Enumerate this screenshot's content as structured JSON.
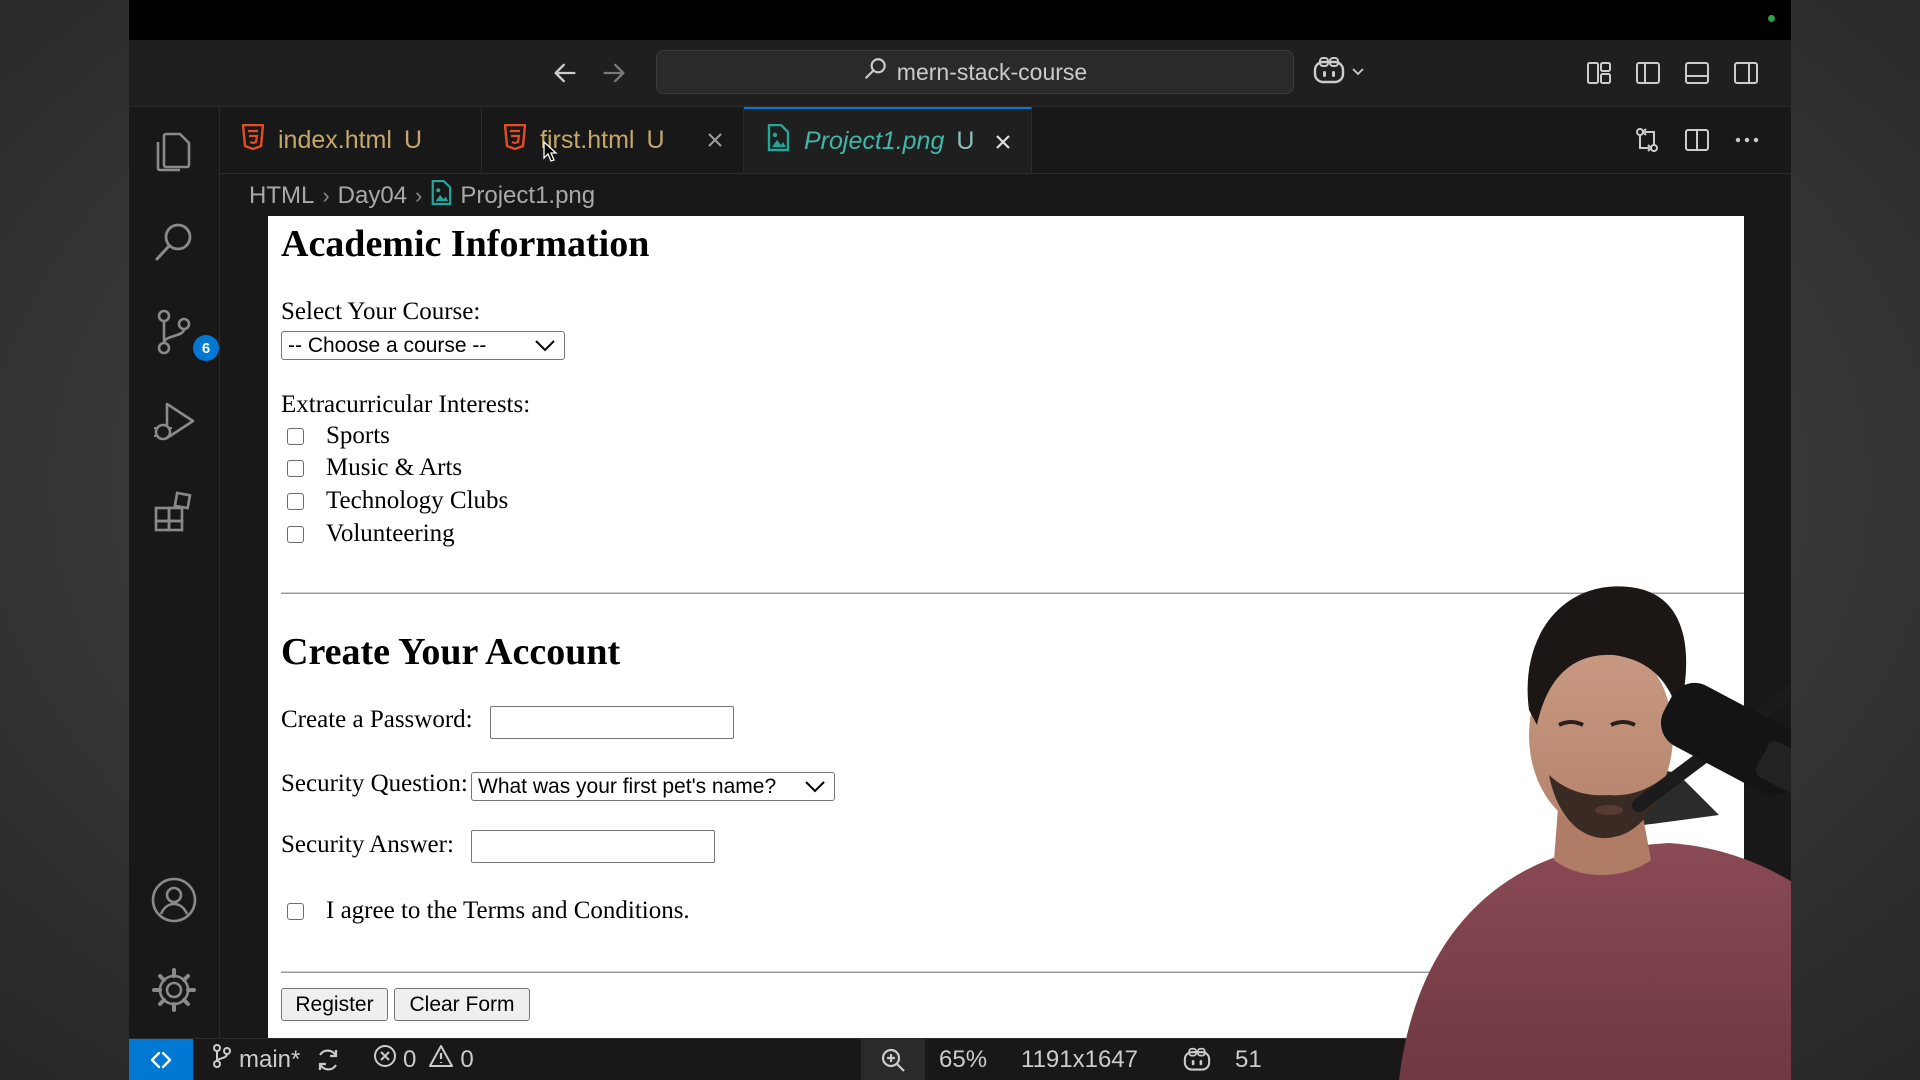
{
  "window": {
    "search_text": "mern-stack-course"
  },
  "activity_bar": {
    "items": [
      {
        "name": "explorer",
        "icon": "files-icon"
      },
      {
        "name": "search",
        "icon": "search-icon"
      },
      {
        "name": "source-control",
        "icon": "source-control-icon",
        "badge": "6"
      },
      {
        "name": "run-and-debug",
        "icon": "run-debug-icon"
      },
      {
        "name": "extensions",
        "icon": "extensions-icon"
      }
    ],
    "bottom_items": [
      {
        "name": "accounts",
        "icon": "account-icon"
      },
      {
        "name": "manage",
        "icon": "gear-icon"
      }
    ]
  },
  "tabs": [
    {
      "label": "index.html",
      "status": "U",
      "icon": "html5-icon",
      "active": false
    },
    {
      "label": "first.html",
      "status": "U",
      "icon": "html5-icon",
      "active": false
    },
    {
      "label": "Project1.png",
      "status": "U",
      "icon": "image-file-icon",
      "active": true
    }
  ],
  "breadcrumb": [
    "HTML",
    "Day04",
    "Project1.png"
  ],
  "preview": {
    "academic_heading": "Academic Information",
    "course_label": "Select Your Course:",
    "course_selected": "-- Choose a course --",
    "interests_label": "Extracurricular Interests:",
    "interests": [
      "Sports",
      "Music & Arts",
      "Technology Clubs",
      "Volunteering"
    ],
    "account_heading": "Create Your Account",
    "password_label": "Create a Password:",
    "security_question_label": "Security Question:",
    "security_question_selected": "What was your first pet's name?",
    "security_answer_label": "Security Answer:",
    "terms_label": "I agree to the Terms and Conditions.",
    "register_button": "Register",
    "clear_button": "Clear Form"
  },
  "status_bar": {
    "branch": "main*",
    "errors": "0",
    "warnings": "0",
    "zoom": "65%",
    "dimensions": "1191x1647",
    "size_partial": "51"
  },
  "colors": {
    "accent_blue": "#0078d4",
    "html_icon_orange": "#e44d26",
    "image_icon_teal": "#26a69a",
    "modified_tab_text": "#c4a769"
  }
}
